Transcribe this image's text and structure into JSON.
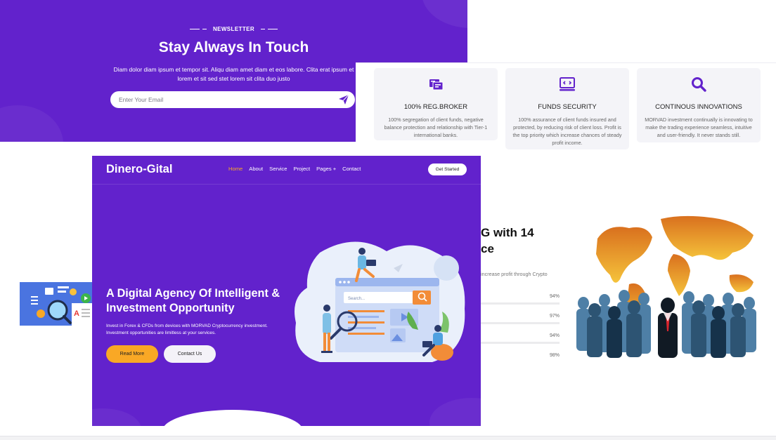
{
  "newsletter": {
    "eyebrow": "NEWSLETTER",
    "title": "Stay Always In Touch",
    "text": "Diam dolor diam ipsum et tempor sit. Aliqu diam amet diam et eos labore. Clita erat ipsum et lorem et sit sed stet lorem sit clita duo justo",
    "email_placeholder": "Enter Your Email",
    "send_icon": "paper-plane-icon"
  },
  "features": [
    {
      "icon": "broker-icon",
      "title": "100% REG.BROKER",
      "text": "100% segregation of client funds, negative balance protection and relationship with Tier-1 international banks."
    },
    {
      "icon": "code-window-icon",
      "title": "FUNDS SECURITY",
      "text": "100% assurance of client funds insured and protected, by reducing risk of client loss. Profit is the top priority which increase chances of steady profit income."
    },
    {
      "icon": "search-icon",
      "title": "CONTINOUS INNOVATIONS",
      "text": "MORVAD investment continually is innovating to make the trading experience seamless, intuitive and user-friendly. It never stands still."
    }
  ],
  "hero": {
    "brand": "Dinero-Gital",
    "menu": [
      "Home",
      "About",
      "Service",
      "Project",
      "Pages +",
      "Contact"
    ],
    "active_menu": "Home",
    "cta": "Get Started",
    "title": "A Digital Agency Of Intelligent & Investment Opportunity",
    "text": "Invest in Forex & CFDs from devices with MORVAD Cryptocurrency investment. Investment opportunities are limitless at your services.",
    "read_more": "Read More",
    "contact": "Contact Us",
    "search_placeholder": "Search..."
  },
  "skills": {
    "title_line1": "G with 14",
    "title_line2": "ce",
    "subtitle": "increase profit through Crypto",
    "values": [
      "94%",
      "97%",
      "94%",
      "98%"
    ]
  },
  "colors": {
    "brand_purple": "#6222CC",
    "accent_orange": "#F9A825",
    "card_bg": "#F4F4F8"
  }
}
